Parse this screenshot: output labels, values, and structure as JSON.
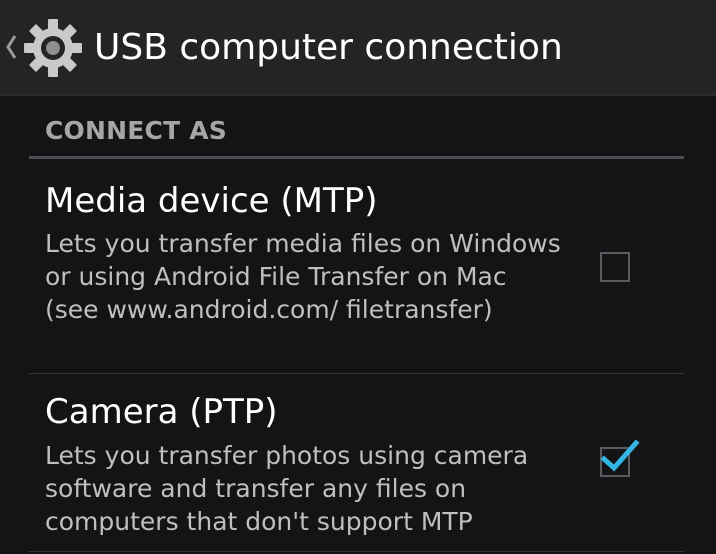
{
  "action_bar": {
    "title": "USB computer connection",
    "up_icon": "chevron-left-icon",
    "app_icon": "gear-icon"
  },
  "section": {
    "header": "CONNECT AS"
  },
  "options": [
    {
      "title": "Media device (MTP)",
      "summary": "Lets you transfer media files on Windows or using Android File Transfer on Mac (see www.android.com/ filetransfer)",
      "checked": false
    },
    {
      "title": "Camera (PTP)",
      "summary": "Lets you transfer photos using camera software and transfer any files on computers that don't support MTP",
      "checked": true
    }
  ],
  "colors": {
    "accent": "#33b5e5",
    "action_bar_bg": "#232425",
    "content_bg": "#131416",
    "section_header": "#a4a6a8",
    "summary_text": "#bdbfc1"
  }
}
